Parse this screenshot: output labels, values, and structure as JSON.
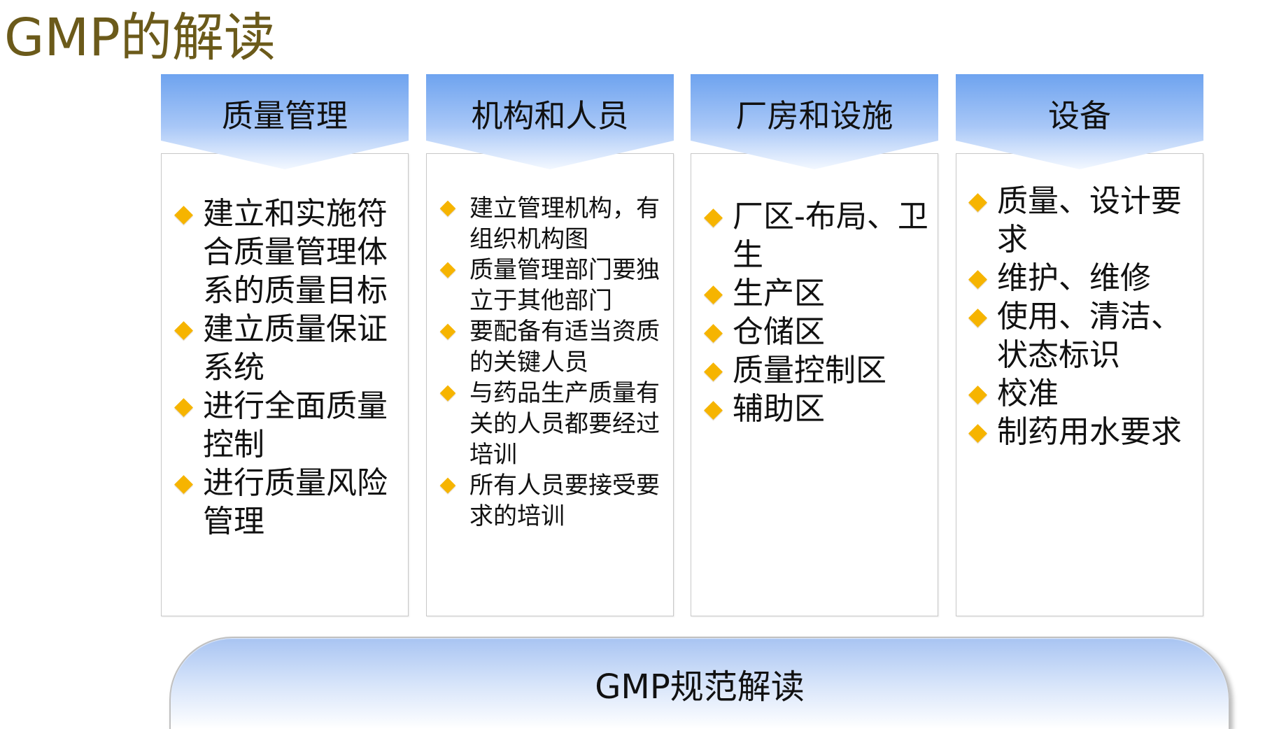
{
  "page": {
    "title": "GMP的解读"
  },
  "columns": [
    {
      "title": "质量管理",
      "items": [
        "建立和实施符合质量管理体系的质量目标",
        "建立质量保证系统",
        "进行全面质量控制",
        "进行质量风险管理"
      ]
    },
    {
      "title": "机构和人员",
      "items": [
        "建立管理机构，有组织机构图",
        "质量管理部门要独立于其他部门",
        "要配备有适当资质的关键人员",
        "与药品生产质量有关的人员都要经过培训",
        "所有人员要接受要求的培训"
      ]
    },
    {
      "title": "厂房和设施",
      "items": [
        "厂区-布局、卫生",
        "生产区",
        "仓储区",
        "质量控制区",
        "辅助区"
      ]
    },
    {
      "title": "设备",
      "items": [
        "质量、设计要求",
        "维护、维修",
        "使用、清洁、状态标识",
        "校准",
        "制药用水要求"
      ]
    }
  ],
  "footer": {
    "label": "GMP规范解读"
  },
  "icons": {
    "bullet": "diamond-bullet-icon"
  },
  "colors": {
    "title_text": "#6b5a1a",
    "header_gradient_top": "#6ea3ef",
    "header_gradient_bottom": "#e9f1ff",
    "bullet": "#f6b400",
    "footer_gradient_top": "#a8c4f2",
    "footer_gradient_bottom": "#ffffff"
  }
}
